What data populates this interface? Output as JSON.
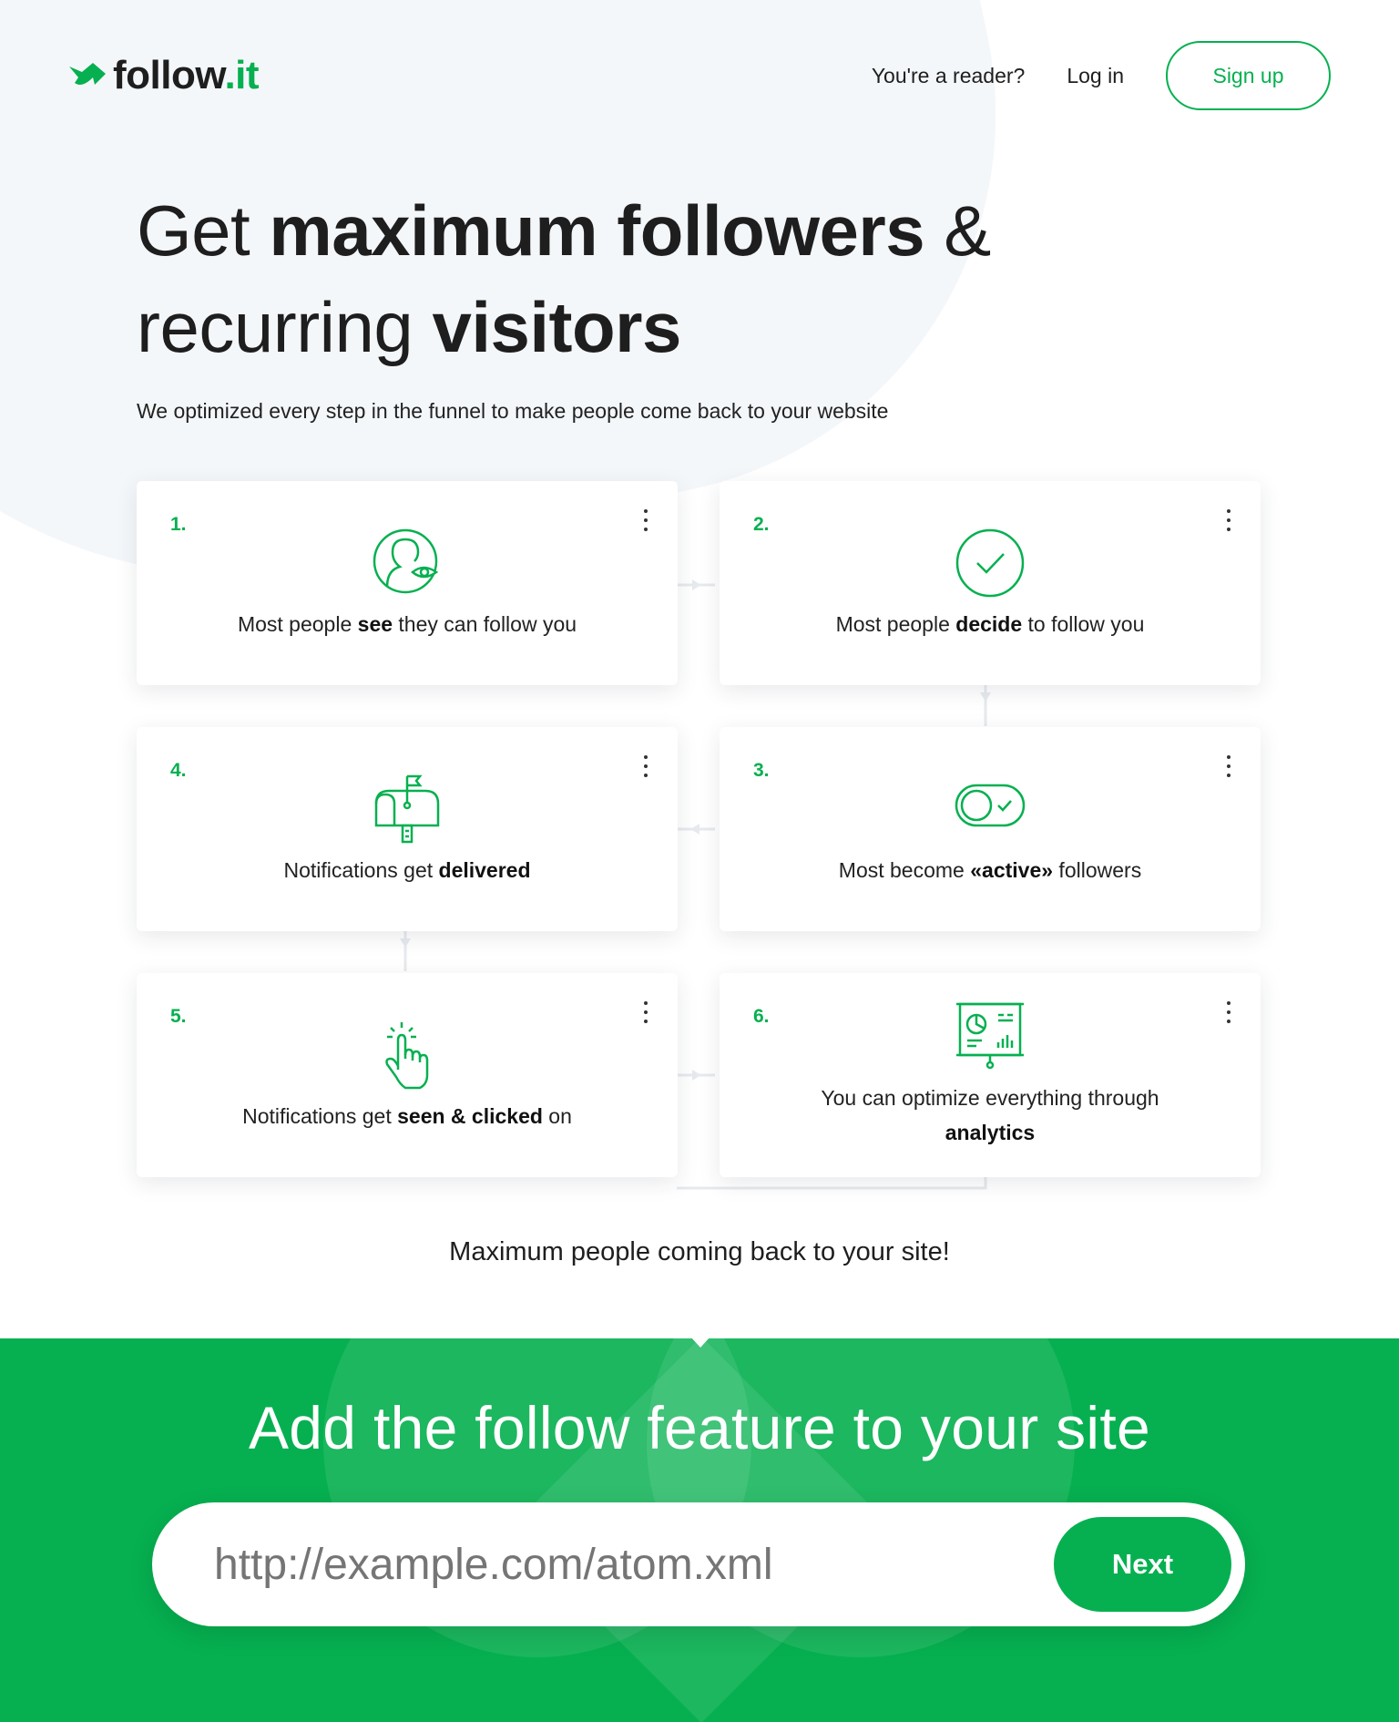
{
  "header": {
    "logo_text_main": "follow",
    "logo_text_suffix": ".it",
    "nav": {
      "reader_link": "You're a reader?",
      "login_link": "Log in",
      "signup_button": "Sign up"
    }
  },
  "hero": {
    "line1_pre": "Get ",
    "line1_bold": "maximum followers",
    "line1_post": " &",
    "line2_pre": "recurring ",
    "line2_bold": "visitors",
    "subtitle": "We optimized every step in the funnel to make people come back to your website"
  },
  "steps": [
    {
      "num": "1.",
      "icon": "person-eye-icon",
      "text_pre": "Most people ",
      "text_bold": "see",
      "text_post": " they can follow you"
    },
    {
      "num": "2.",
      "icon": "check-circle-icon",
      "text_pre": "Most people ",
      "text_bold": "decide",
      "text_post": " to follow you"
    },
    {
      "num": "3.",
      "icon": "toggle-check-icon",
      "text_pre": "Most become ",
      "text_bold": "«active»",
      "text_post": " followers"
    },
    {
      "num": "4.",
      "icon": "mailbox-icon",
      "text_pre": "Notifications get ",
      "text_bold": "delivered",
      "text_post": ""
    },
    {
      "num": "5.",
      "icon": "pointer-hand-icon",
      "text_pre": "Notifications get ",
      "text_bold": "seen & clicked",
      "text_post": " on"
    },
    {
      "num": "6.",
      "icon": "analytics-board-icon",
      "text_pre": "You can optimize everything through",
      "text_bold": "analytics",
      "text_post": ""
    }
  ],
  "tagline": "Maximum people coming back to your site!",
  "cta": {
    "heading": "Add the follow feature to your site",
    "input_placeholder": "http://example.com/atom.xml",
    "next_button": "Next"
  },
  "colors": {
    "accent": "#06b050",
    "text": "#1e1e1e",
    "background_shape": "#f4f7fa"
  }
}
